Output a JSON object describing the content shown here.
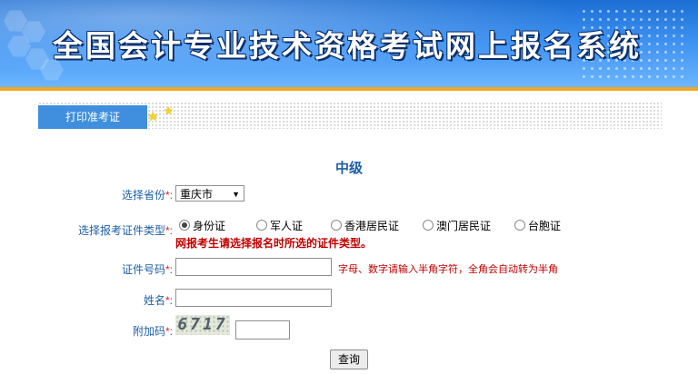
{
  "header": {
    "title": "全国会计专业技术资格考试网上报名系统"
  },
  "nav": {
    "tab_label": "打印准考证"
  },
  "form": {
    "level": "中级",
    "province_label": "选择省份",
    "province_value": "重庆市",
    "id_type_label": "选择报考证件类型",
    "id_types": [
      "身份证",
      "军人证",
      "香港居民证",
      "澳门居民证",
      "台胞证"
    ],
    "id_type_selected": "身份证",
    "id_type_warning": "网报考生请选择报名时所选的证件类型。",
    "id_number_label": "证件号码",
    "id_number_value": "",
    "id_number_hint": "字母、数字请输入半角字符，全角会自动转为半角",
    "name_label": "姓名",
    "name_value": "",
    "captcha_label": "附加码",
    "captcha_text": "6717",
    "captcha_value": "",
    "required_mark": "*",
    "colon": ":",
    "submit_label": "查询"
  },
  "colors": {
    "accent_blue": "#3f8fde",
    "label_blue": "#1d5fa6",
    "warning_red": "#c00000",
    "banner_stripe": "#f3a422"
  }
}
